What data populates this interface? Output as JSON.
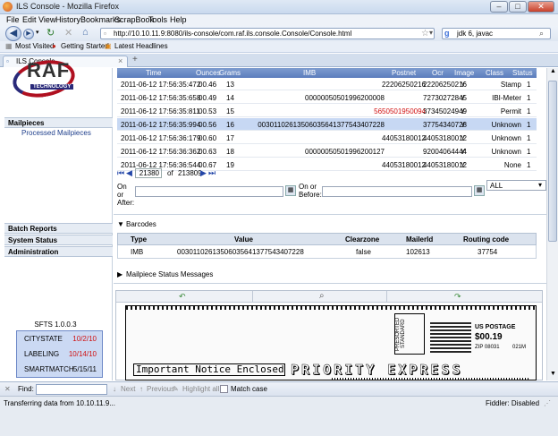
{
  "window": {
    "title": "ILS Console - Mozilla Firefox"
  },
  "menu": [
    "File",
    "Edit",
    "View",
    "History",
    "Bookmarks",
    "ScrapBook",
    "Tools",
    "Help"
  ],
  "nav": {
    "url": "http://10.10.11.9:8080/ils-console/com.raf.ils.console.Console/Console.html",
    "search_value": "jdk 6, javac"
  },
  "bookmarks": [
    "Most Visited",
    "Getting Started",
    "Latest Headlines"
  ],
  "tab": {
    "label": "ILS Console",
    "new_tab": "+"
  },
  "logo": {
    "text": "RAF",
    "sub": "TECHNOLOGY"
  },
  "sidebar": {
    "sections": [
      {
        "label": "Mailpieces"
      },
      {
        "label": "Batch Reports"
      },
      {
        "label": "System Status"
      },
      {
        "label": "Administration"
      }
    ],
    "subitem": "Processed Mailpieces",
    "version": "SFTS 1.0.0.3",
    "versions": [
      {
        "name": "CITYSTATE",
        "date": "10/2/10",
        "color": "#d01010"
      },
      {
        "name": "LABELING",
        "date": "10/14/10",
        "color": "#d01010"
      },
      {
        "name": "SMARTMATCH",
        "date": "5/15/11",
        "color": "#000000"
      }
    ]
  },
  "mailtable": {
    "headers": [
      "Time",
      "Ounces",
      "Grams",
      "IMB",
      "Postnet",
      "Ocr",
      "Image",
      "Class",
      "Status"
    ],
    "rows": [
      {
        "time": "2011-06-12 17:56:35:472",
        "ounces": "00.46",
        "grams": "13",
        "imb": "",
        "postnet": "22206250216",
        "ocr": "22206250216",
        "image": "Y",
        "class": "Stamp",
        "status": "1",
        "postnet_red": false,
        "selected": false
      },
      {
        "time": "2011-06-12 17:56:35:658",
        "ounces": "00.49",
        "grams": "14",
        "imb": "00000050501996200008",
        "postnet": "",
        "ocr": "72730272845",
        "image": "Y",
        "class": "IBI-Meter",
        "status": "1",
        "postnet_red": false,
        "selected": false
      },
      {
        "time": "2011-06-12 17:56:35:811",
        "ounces": "00.53",
        "grams": "15",
        "imb": "",
        "postnet": "5650501950094",
        "ocr": "37345024949",
        "image": "Y",
        "class": "Permit",
        "status": "1",
        "postnet_red": true,
        "selected": false
      },
      {
        "time": "2011-06-12 17:56:35:994",
        "ounces": "00.56",
        "grams": "16",
        "imb": "00301102613506035641377543407228",
        "postnet": "",
        "ocr": "37754340728",
        "image": "Y",
        "class": "Unknown",
        "status": "1",
        "postnet_red": false,
        "selected": true
      },
      {
        "time": "2011-06-12 17:56:36:179",
        "ounces": "00.60",
        "grams": "17",
        "imb": "",
        "postnet": "44053180012",
        "ocr": "44053180012",
        "image": "Y",
        "class": "Unknown",
        "status": "1",
        "postnet_red": false,
        "selected": false
      },
      {
        "time": "2011-06-12 17:56:36:362",
        "ounces": "00.63",
        "grams": "18",
        "imb": "00000050501996200127",
        "postnet": "",
        "ocr": "92004064444",
        "image": "Y",
        "class": "Unknown",
        "status": "1",
        "postnet_red": false,
        "selected": false
      },
      {
        "time": "2011-06-12 17:56:36:544",
        "ounces": "00.67",
        "grams": "19",
        "imb": "",
        "postnet": "44053180012",
        "ocr": "44053180012",
        "image": "Y",
        "class": "None",
        "status": "1",
        "postnet_red": false,
        "selected": false
      }
    ]
  },
  "pager": {
    "current": "21380",
    "of": "of",
    "total": "213809"
  },
  "filter": {
    "after_label": "On or After:",
    "before_label": "On or Before:",
    "select_value": "ALL"
  },
  "barcodes": {
    "title": "Barcodes",
    "headers": [
      "Type",
      "Value",
      "Clearzone",
      "MailerId",
      "Routing code"
    ],
    "row": {
      "type": "IMB",
      "value": "00301102613506035641377543407228",
      "clearzone": "false",
      "mailerid": "102613",
      "routing": "37754"
    }
  },
  "status_messages": {
    "title": "Mailpiece Status Messages"
  },
  "image": {
    "line1": "Important Notice Enclosed",
    "line2": "PRIORITY EXPRESS",
    "presorted": "PRESORTED STANDARD",
    "postage": "US POSTAGE",
    "amount": "$00.19",
    "zip": "ZIP 08031",
    "code": "021M"
  },
  "findbar": {
    "label": "Find:",
    "next": "Next",
    "previous": "Previous",
    "highlight": "Highlight all",
    "match": "Match case"
  },
  "statusbar": {
    "text": "Transferring data from 10.10.11.9...",
    "right": "Fiddler: Disabled"
  }
}
